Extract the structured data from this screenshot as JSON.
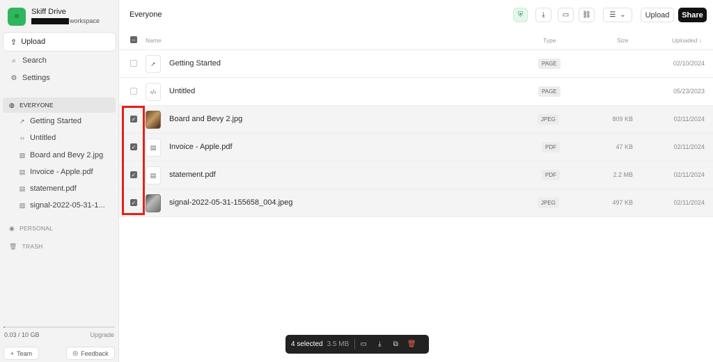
{
  "sidebar": {
    "brand_name": "Skiff Drive",
    "brand_sub": "workspace",
    "logo_glyph": "⊡",
    "upload_label": "Upload",
    "nav": [
      {
        "label": "Search",
        "icon": "search-icon"
      },
      {
        "label": "Settings",
        "icon": "gear-icon"
      }
    ],
    "sections": {
      "everyone": "EVERYONE",
      "personal": "PERSONAL",
      "trash": "TRASH"
    },
    "tree": [
      {
        "label": "Getting Started",
        "icon": "rocket-icon"
      },
      {
        "label": "Untitled",
        "icon": "code-icon"
      },
      {
        "label": "Board and Bevy 2.jpg",
        "icon": "image-icon"
      },
      {
        "label": "Invoice - Apple.pdf",
        "icon": "file-icon"
      },
      {
        "label": "statement.pdf",
        "icon": "file-icon"
      },
      {
        "label": "signal-2022-05-31-1...",
        "icon": "image-icon"
      }
    ],
    "storage": {
      "used": "0.03 / 10 GB",
      "fraction": 0.003,
      "upgrade": "Upgrade"
    },
    "team_label": "Team",
    "feedback_label": "Feedback"
  },
  "main": {
    "title": "Everyone",
    "toolbar": {
      "upload": "Upload",
      "share": "Share"
    },
    "columns": {
      "name": "Name",
      "type": "Type",
      "size": "Size",
      "uploaded": "Uploaded ↓"
    },
    "rows": [
      {
        "name": "Getting Started",
        "type": "PAGE",
        "size": "",
        "date": "02/10/2024",
        "checked": false
      },
      {
        "name": "Untitled",
        "type": "PAGE",
        "size": "",
        "date": "05/23/2023",
        "checked": false
      },
      {
        "name": "Board and Bevy 2.jpg",
        "type": "JPEG",
        "size": "809 KB",
        "date": "02/11/2024",
        "checked": true
      },
      {
        "name": "Invoice - Apple.pdf",
        "type": "PDF",
        "size": "47 KB",
        "date": "02/11/2024",
        "checked": true
      },
      {
        "name": "statement.pdf",
        "type": "PDF",
        "size": "2.2 MB",
        "date": "02/11/2024",
        "checked": true
      },
      {
        "name": "signal-2022-05-31-155658_004.jpeg",
        "type": "JPEG",
        "size": "497 KB",
        "date": "02/11/2024",
        "checked": true
      }
    ]
  },
  "selection": {
    "count_label": "4 selected",
    "size_label": "3.5 MB"
  },
  "colors": {
    "accent_green": "#2fb65b",
    "highlight_red": "#e3211d",
    "danger": "#ff5a4e"
  }
}
